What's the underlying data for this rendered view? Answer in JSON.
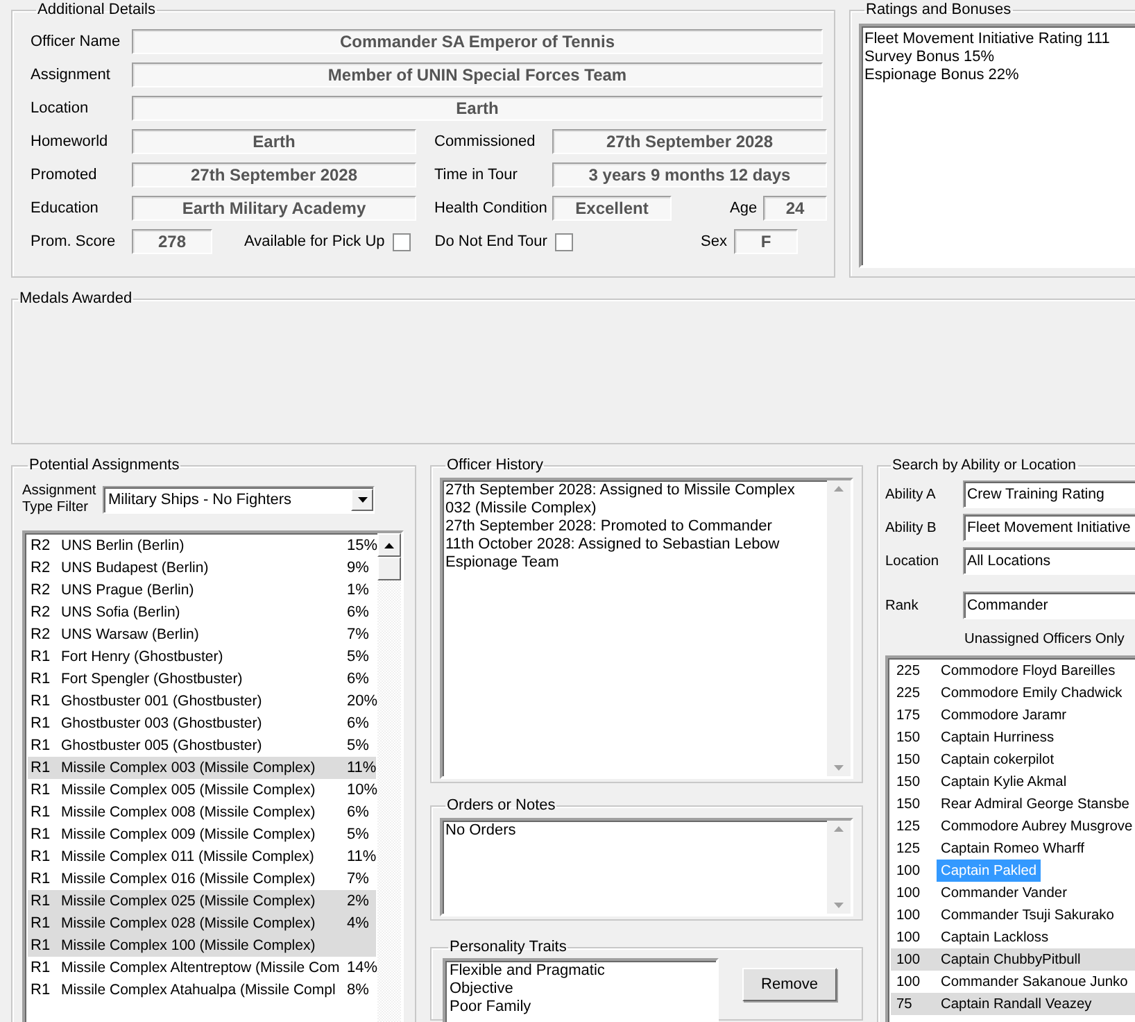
{
  "details": {
    "title": "Additional Details",
    "officer_name": {
      "label": "Officer Name",
      "value": "Commander SA Emperor of Tennis"
    },
    "assignment": {
      "label": "Assignment",
      "value": "Member of UNIN Special Forces Team"
    },
    "location": {
      "label": "Location",
      "value": "Earth"
    },
    "homeworld": {
      "label": "Homeworld",
      "value": "Earth"
    },
    "commissioned": {
      "label": "Commissioned",
      "value": "27th September 2028"
    },
    "promoted": {
      "label": "Promoted",
      "value": "27th September 2028"
    },
    "time_in_tour": {
      "label": "Time in Tour",
      "value": "3 years 9 months 12 days"
    },
    "education": {
      "label": "Education",
      "value": "Earth Military Academy"
    },
    "health_condition": {
      "label": "Health Condition",
      "value": "Excellent"
    },
    "age": {
      "label": "Age",
      "value": "24"
    },
    "prom_score": {
      "label": "Prom. Score",
      "value": "278"
    },
    "available_for_pick_up": {
      "label": "Available for Pick Up",
      "checked": false
    },
    "do_not_end_tour": {
      "label": "Do Not End Tour",
      "checked": false
    },
    "sex": {
      "label": "Sex",
      "value": "F"
    }
  },
  "ratings": {
    "title": "Ratings and Bonuses",
    "lines": [
      "Fleet Movement Initiative Rating 111",
      "Survey Bonus 15%",
      "Espionage Bonus 22%"
    ]
  },
  "medals": {
    "title": "Medals Awarded"
  },
  "potential_assignments": {
    "title": "Potential Assignments",
    "filter": {
      "label": "Assignment Type Filter",
      "value": "Military Ships - No Fighters"
    },
    "rows": [
      {
        "rank": "R2",
        "name": "UNS Berlin (Berlin)",
        "chance": "15%",
        "highlighted": false
      },
      {
        "rank": "R2",
        "name": "UNS Budapest (Berlin)",
        "chance": "9%",
        "highlighted": false
      },
      {
        "rank": "R2",
        "name": "UNS Prague (Berlin)",
        "chance": "1%",
        "highlighted": false
      },
      {
        "rank": "R2",
        "name": "UNS Sofia (Berlin)",
        "chance": "6%",
        "highlighted": false
      },
      {
        "rank": "R2",
        "name": "UNS Warsaw (Berlin)",
        "chance": "7%",
        "highlighted": false
      },
      {
        "rank": "R1",
        "name": "Fort Henry (Ghostbuster)",
        "chance": "5%",
        "highlighted": false
      },
      {
        "rank": "R1",
        "name": "Fort Spengler (Ghostbuster)",
        "chance": "6%",
        "highlighted": false
      },
      {
        "rank": "R1",
        "name": "Ghostbuster 001 (Ghostbuster)",
        "chance": "20%",
        "highlighted": false
      },
      {
        "rank": "R1",
        "name": "Ghostbuster 003 (Ghostbuster)",
        "chance": "6%",
        "highlighted": false
      },
      {
        "rank": "R1",
        "name": "Ghostbuster 005 (Ghostbuster)",
        "chance": "5%",
        "highlighted": false
      },
      {
        "rank": "R1",
        "name": "Missile Complex 003 (Missile Complex)",
        "chance": "11%",
        "highlighted": true
      },
      {
        "rank": "R1",
        "name": "Missile Complex 005 (Missile Complex)",
        "chance": "10%",
        "highlighted": false
      },
      {
        "rank": "R1",
        "name": "Missile Complex 008 (Missile Complex)",
        "chance": "6%",
        "highlighted": false
      },
      {
        "rank": "R1",
        "name": "Missile Complex 009 (Missile Complex)",
        "chance": "5%",
        "highlighted": false
      },
      {
        "rank": "R1",
        "name": "Missile Complex 011 (Missile Complex)",
        "chance": "11%",
        "highlighted": false
      },
      {
        "rank": "R1",
        "name": "Missile Complex 016 (Missile Complex)",
        "chance": "7%",
        "highlighted": false
      },
      {
        "rank": "R1",
        "name": "Missile Complex 025 (Missile Complex)",
        "chance": "2%",
        "highlighted": true
      },
      {
        "rank": "R1",
        "name": "Missile Complex 028 (Missile Complex)",
        "chance": "4%",
        "highlighted": true
      },
      {
        "rank": "R1",
        "name": "Missile Complex 100 (Missile Complex)",
        "highlighted": true
      },
      {
        "rank": "R1",
        "name": "Missile Complex Altentreptow (Missile Com",
        "chance": "14%",
        "highlighted": false
      },
      {
        "rank": "R1",
        "name": "Missile Complex Atahualpa (Missile Compl",
        "chance": "8%",
        "highlighted": false
      }
    ]
  },
  "officer_history": {
    "title": "Officer History",
    "entries": [
      "27th September 2028: Assigned to Missile Complex 032 (Missile Complex)",
      "27th September 2028: Promoted to Commander",
      "11th October 2028: Assigned to Sebastian Lebow Espionage Team"
    ]
  },
  "orders": {
    "title": "Orders or Notes",
    "text": "No Orders"
  },
  "personality_traits": {
    "title": "Personality Traits",
    "traits": [
      "Flexible and Pragmatic",
      "Objective",
      "Poor Family"
    ],
    "remove_button": "Remove"
  },
  "search": {
    "title": "Search by Ability or Location",
    "ability_a": {
      "label": "Ability A",
      "value": "Crew Training Rating"
    },
    "ability_b": {
      "label": "Ability B",
      "value": "Fleet Movement Initiative"
    },
    "location": {
      "label": "Location",
      "value": "All Locations"
    },
    "rank": {
      "label": "Rank",
      "value": "Commander"
    },
    "unassigned_only": {
      "label": "Unassigned Officers Only"
    },
    "officers": [
      {
        "score": "225",
        "name": "Commodore Floyd Bareilles",
        "selected": false,
        "highlighted": false
      },
      {
        "score": "225",
        "name": "Commodore Emily Chadwick",
        "selected": false,
        "highlighted": false
      },
      {
        "score": "175",
        "name": "Commodore Jaramr",
        "selected": false,
        "highlighted": false
      },
      {
        "score": "150",
        "name": "Captain Hurriness",
        "selected": false,
        "highlighted": false
      },
      {
        "score": "150",
        "name": "Captain cokerpilot",
        "selected": false,
        "highlighted": false
      },
      {
        "score": "150",
        "name": "Captain Kylie Akmal",
        "selected": false,
        "highlighted": false
      },
      {
        "score": "150",
        "name": "Rear Admiral George Stansbe",
        "selected": false,
        "highlighted": false
      },
      {
        "score": "125",
        "name": "Commodore Aubrey Musgrove",
        "selected": false,
        "highlighted": false
      },
      {
        "score": "125",
        "name": "Captain Romeo Wharff",
        "selected": false,
        "highlighted": false
      },
      {
        "score": "100",
        "name": "Captain Pakled",
        "selected": true,
        "highlighted": false
      },
      {
        "score": "100",
        "name": "Commander Vander",
        "selected": false,
        "highlighted": false
      },
      {
        "score": "100",
        "name": "Commander Tsuji Sakurako",
        "selected": false,
        "highlighted": false
      },
      {
        "score": "100",
        "name": "Captain Lackloss",
        "selected": false,
        "highlighted": false
      },
      {
        "score": "100",
        "name": "Captain ChubbyPitbull",
        "selected": false,
        "highlighted": true
      },
      {
        "score": "100",
        "name": "Commander Sakanoue Junko",
        "selected": false,
        "highlighted": false
      },
      {
        "score": "75",
        "name": "Captain Randall Veazey",
        "selected": false,
        "highlighted": true
      }
    ]
  }
}
